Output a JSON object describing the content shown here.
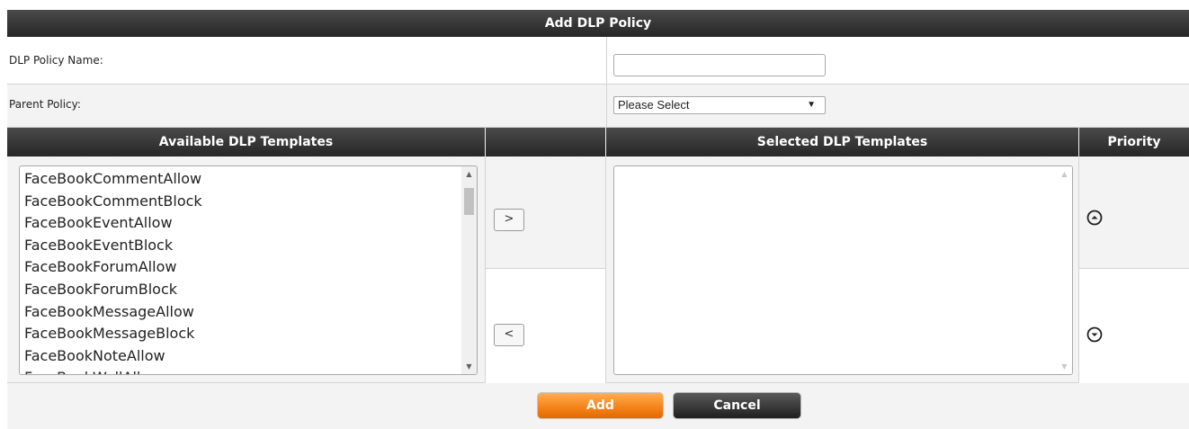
{
  "form": {
    "title": "Add DLP Policy",
    "policy_name_label": "DLP Policy Name:",
    "policy_name_value": "",
    "parent_policy_label": "Parent Policy:",
    "parent_policy_selected": "Please Select",
    "parent_policy_arrow": "▼"
  },
  "templates": {
    "available_header": "Available DLP Templates",
    "selected_header": "Selected DLP Templates",
    "priority_header": "Priority",
    "available_items": [
      "FaceBookCommentAllow",
      "FaceBookCommentBlock",
      "FaceBookEventAllow",
      "FaceBookEventBlock",
      "FaceBookForumAllow",
      "FaceBookForumBlock",
      "FaceBookMessageAllow",
      "FaceBookMessageBlock",
      "FaceBookNoteAllow",
      "FaceBookWallAllow"
    ],
    "selected_items": [],
    "move_right_label": ">",
    "move_left_label": "<",
    "priority_up_glyph": "⊙",
    "priority_down_glyph": "⊙"
  },
  "buttons": {
    "add_label": "Add",
    "cancel_label": "Cancel"
  },
  "colors": {
    "header_bg": "#333333",
    "add_button": "#f5841b",
    "cancel_button": "#2a2a2a",
    "panel_bg": "#f3f3f3"
  },
  "icons": {
    "priority_up": "circle-chevron-up-icon",
    "priority_down": "circle-chevron-down-icon",
    "scroll_up": "scroll-up-arrow-icon",
    "scroll_down": "scroll-down-arrow-icon"
  }
}
